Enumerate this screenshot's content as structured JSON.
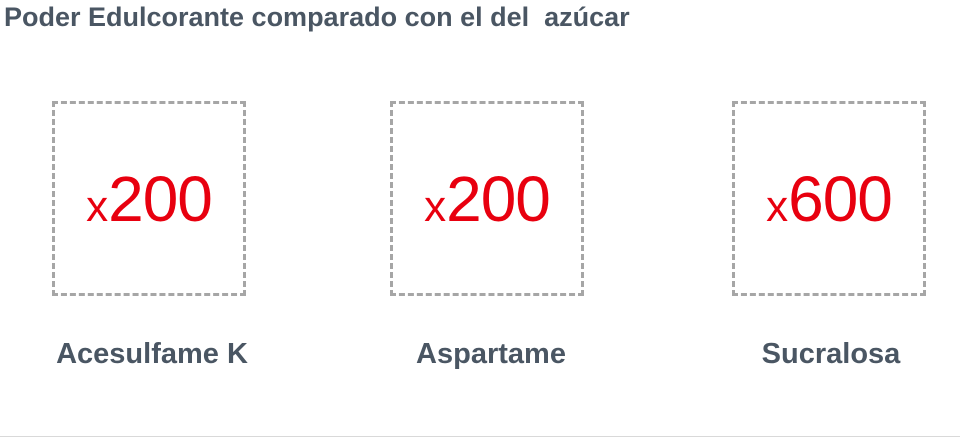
{
  "title": "Poder Edulcorante comparado con el del  azúcar",
  "items": [
    {
      "prefix": "x",
      "number": "200",
      "label": "Acesulfame K"
    },
    {
      "prefix": "x",
      "number": "200",
      "label": "Aspartame"
    },
    {
      "prefix": "x",
      "number": "600",
      "label": "Sucralosa"
    }
  ],
  "colors": {
    "text": "#4a5663",
    "accent": "#e8000f",
    "dashed_border": "#a6a6a6"
  }
}
